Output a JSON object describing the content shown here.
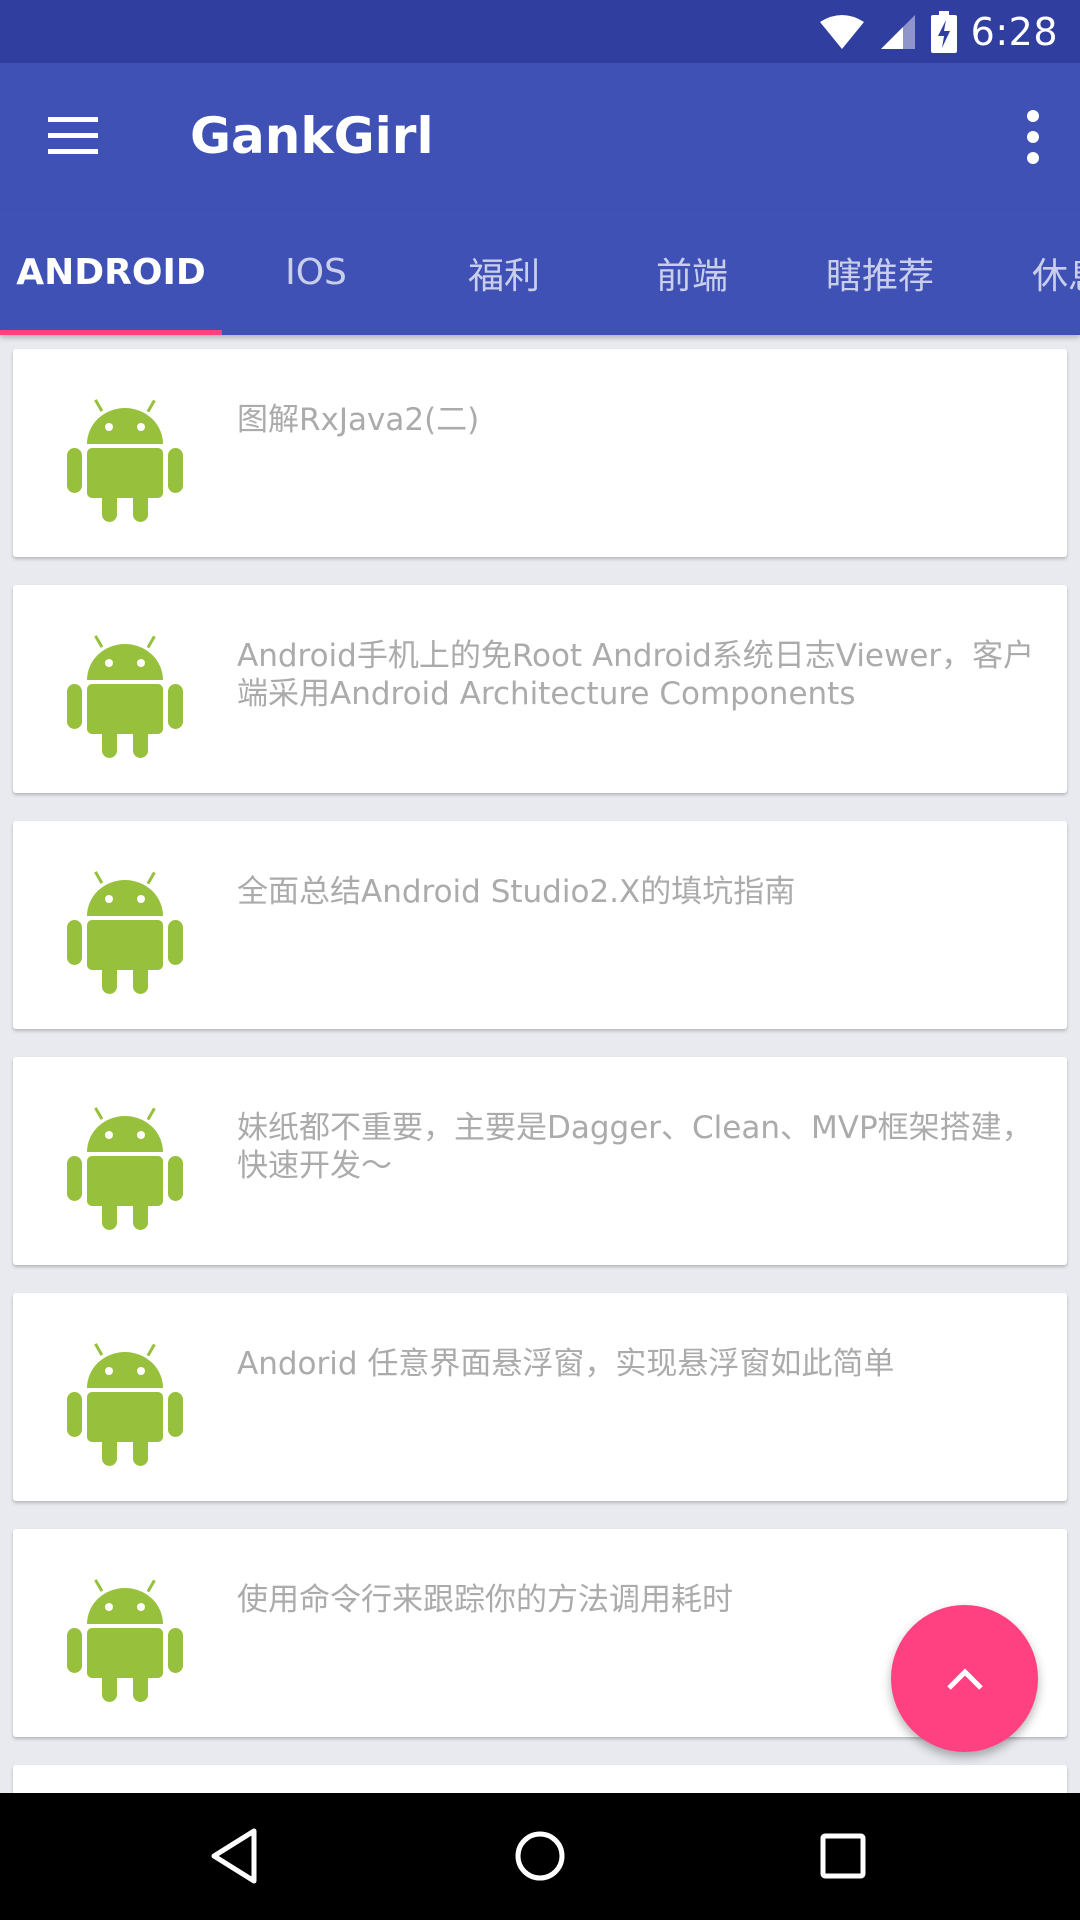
{
  "status_bar": {
    "time": "6:28",
    "icons": [
      "wifi-icon",
      "signal-icon",
      "battery-charging-icon"
    ]
  },
  "app_bar": {
    "title": "GankGirl",
    "menu_icon": "hamburger-menu-icon",
    "overflow_icon": "more-vert-icon"
  },
  "tabs": [
    {
      "label": "ANDROID",
      "active": true
    },
    {
      "label": "IOS",
      "active": false
    },
    {
      "label": "福利",
      "active": false
    },
    {
      "label": "前端",
      "active": false
    },
    {
      "label": "瞎推荐",
      "active": false
    },
    {
      "label": "休息",
      "active": false
    }
  ],
  "articles": [
    {
      "title": "图解RxJava2(二)",
      "icon": "android-robot-icon"
    },
    {
      "title": "Android手机上的免Root Android系统日志Viewer，客户端采用Android Architecture Components",
      "icon": "android-robot-icon"
    },
    {
      "title": "全面总结Android Studio2.X的填坑指南",
      "icon": "android-robot-icon"
    },
    {
      "title": "妹纸都不重要，主要是Dagger、Clean、MVP框架搭建，快速开发～",
      "icon": "android-robot-icon"
    },
    {
      "title": "Andorid 任意界面悬浮窗，实现悬浮窗如此简单",
      "icon": "android-robot-icon"
    },
    {
      "title": "使用命令行来跟踪你的方法调用耗时",
      "icon": "android-robot-icon"
    }
  ],
  "fab": {
    "icon": "chevron-up-icon"
  },
  "nav_bar": {
    "icons": [
      "back-icon",
      "home-icon",
      "recents-icon"
    ]
  },
  "colors": {
    "primary": "#3F51B5",
    "primary_dark": "#303F9F",
    "accent": "#FF4081",
    "android_green": "#97C03D",
    "item_text": "#ABABAB"
  }
}
